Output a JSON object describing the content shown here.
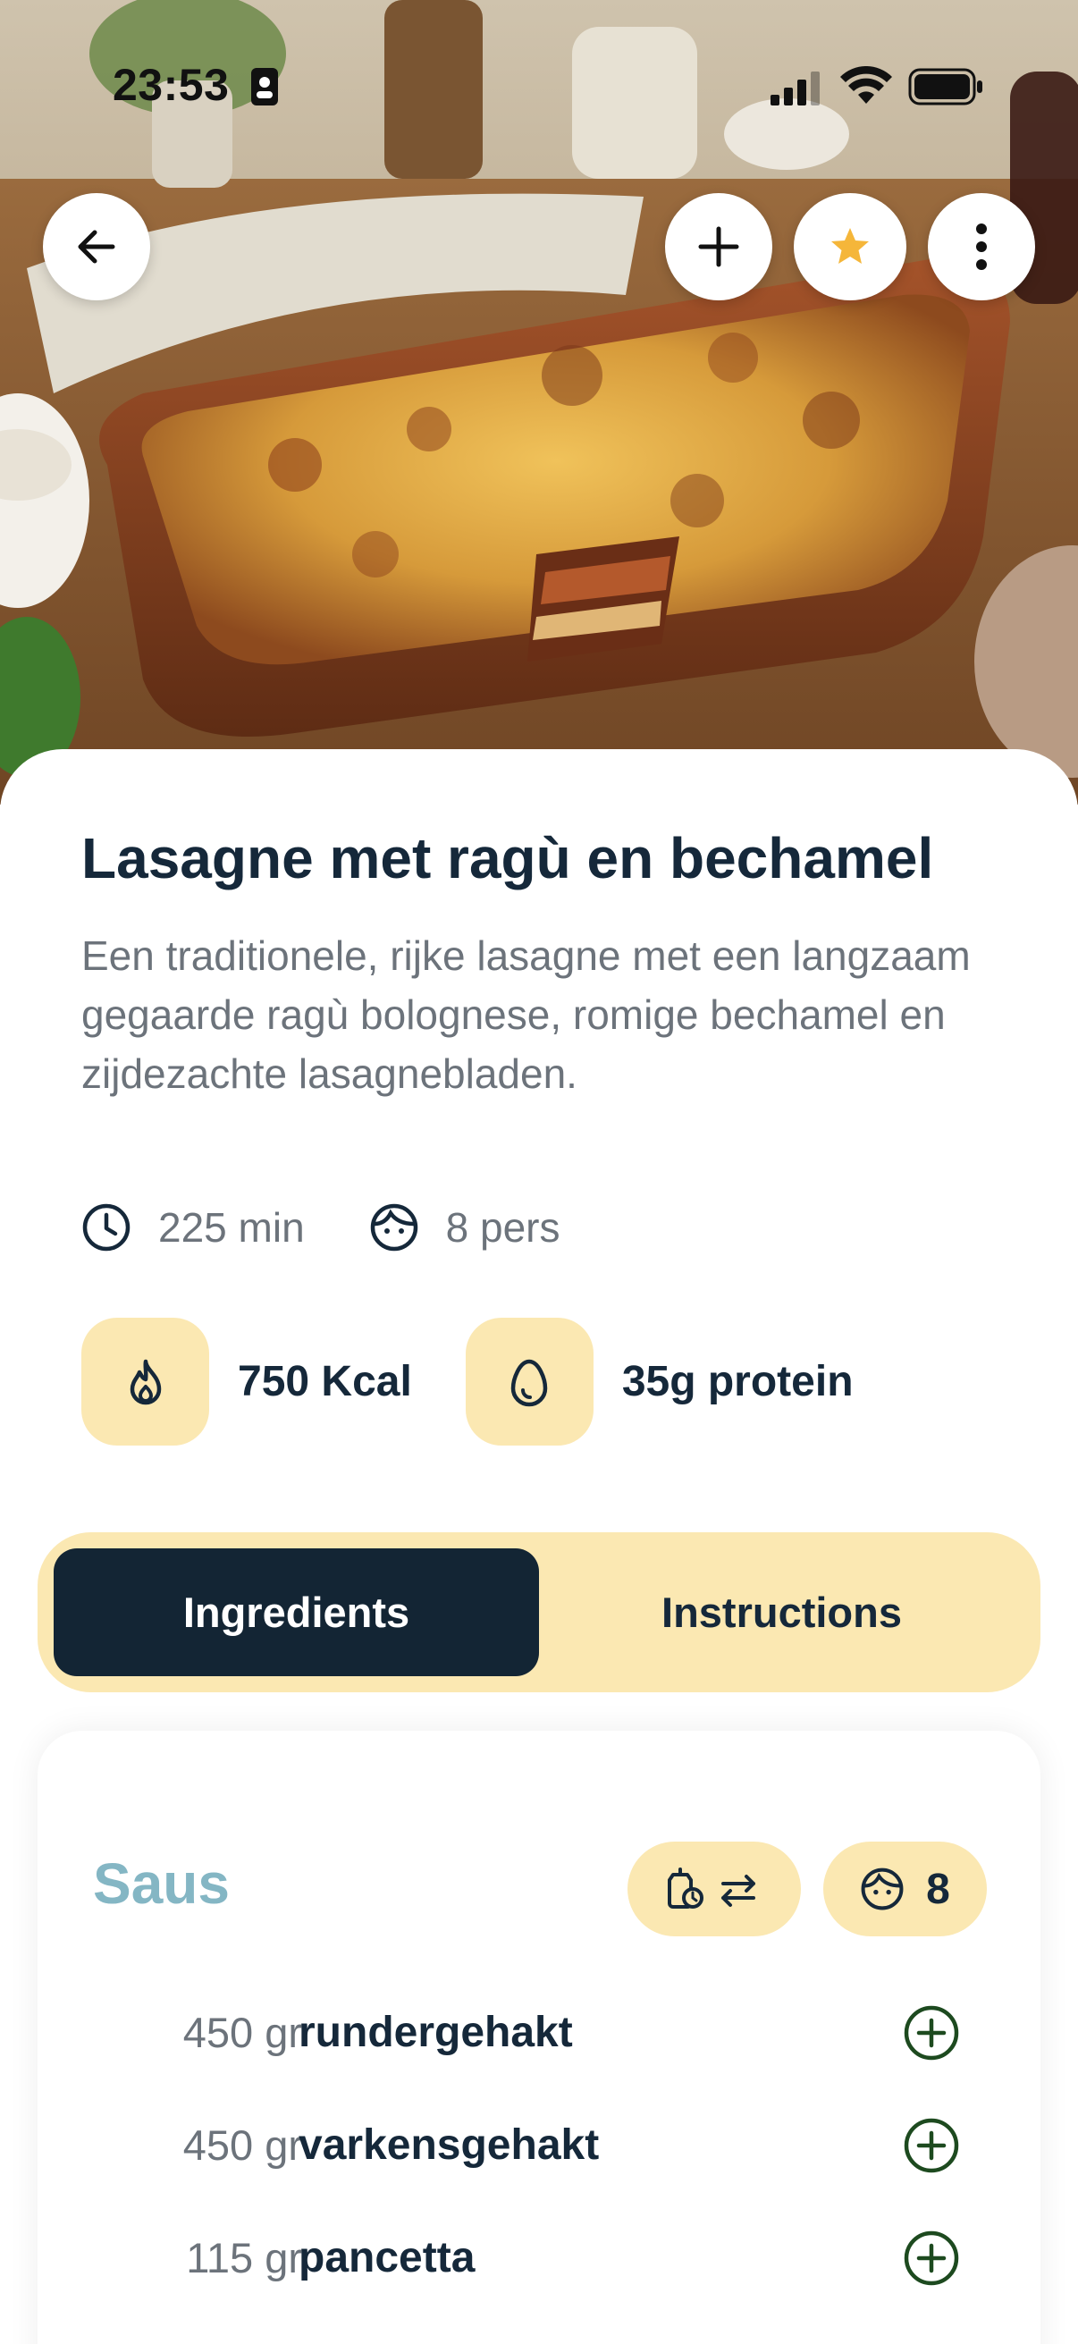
{
  "status_bar": {
    "time": "23:53"
  },
  "header": {
    "icons": [
      "arrow-left-icon",
      "plus-icon",
      "star-icon",
      "more-vertical-icon"
    ],
    "star_color": "#f5b63a"
  },
  "recipe": {
    "title": "Lasagne met ragù en bechamel",
    "description": "Een traditionele, rijke lasagne met een langzaam gegaarde ragù bolognese, romige bechamel en zijdezachte lasagnebladen.",
    "time": "225 min",
    "servings": "8 pers",
    "calories": "750 Kcal",
    "protein": "35g protein"
  },
  "tabs": [
    {
      "label": "Ingredients",
      "active": true
    },
    {
      "label": "Instructions",
      "active": false
    }
  ],
  "ingredients_section": {
    "title": "Saus",
    "servings_count": "8",
    "items": [
      {
        "qty": "450 gr",
        "name": "rundergehakt"
      },
      {
        "qty": "450 gr",
        "name": "varkensgehakt"
      },
      {
        "qty": "115 gr",
        "name": "pancetta"
      }
    ]
  },
  "colors": {
    "accent_yellow": "#fbe8b2",
    "dark_navy": "#132534",
    "section_title": "#84b6c4",
    "add_icon_green": "#1d4a1f"
  }
}
